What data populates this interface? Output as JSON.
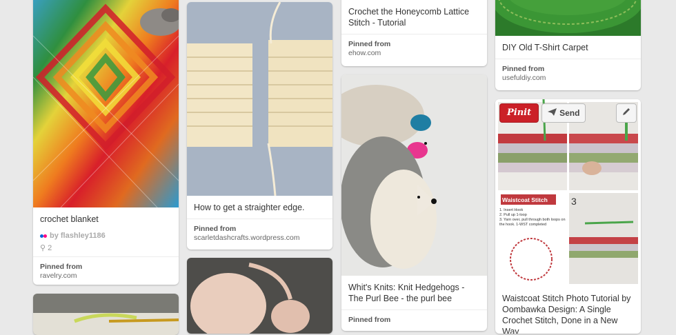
{
  "pins": {
    "p1": {
      "description": "crochet blanket",
      "pinner": "by flashley1186",
      "repins": "2",
      "pinned_label": "Pinned from",
      "source": "ravelry.com"
    },
    "p2": {
      "description": "How to get a straighter edge.",
      "pinned_label": "Pinned from",
      "source": "scarletdashcrafts.wordpress.com"
    },
    "p3": {
      "description": "Crochet the Honeycomb Lattice Stitch - Tutorial",
      "pinned_label": "Pinned from",
      "source": "ehow.com"
    },
    "p4": {
      "description": "Whit's Knits: Knit Hedgehogs - The Purl Bee - the purl bee",
      "pinned_label": "Pinned from"
    },
    "p5": {
      "description": "DIY Old T-Shirt Carpet",
      "pinned_label": "Pinned from",
      "source": "usefuldiy.com"
    },
    "p6": {
      "pinit_label": "Pinit",
      "send_label": "Send",
      "image_title": "Waistcoat Stitch",
      "image_steps": [
        "1. Insert Hook",
        "2. Pull up 1-loop",
        "3. Yarn over, pull through both loops on the hook. 1-WST completed"
      ],
      "image_number": "3",
      "description": "Waistcoat Stitch Photo Tutorial by Oombawka Design: A Single Crochet Stitch, Done in a New Way"
    }
  },
  "colors": {
    "pinit_red": "#cb2027",
    "flickr_blue": "#0063dc",
    "flickr_pink": "#ff0084"
  }
}
